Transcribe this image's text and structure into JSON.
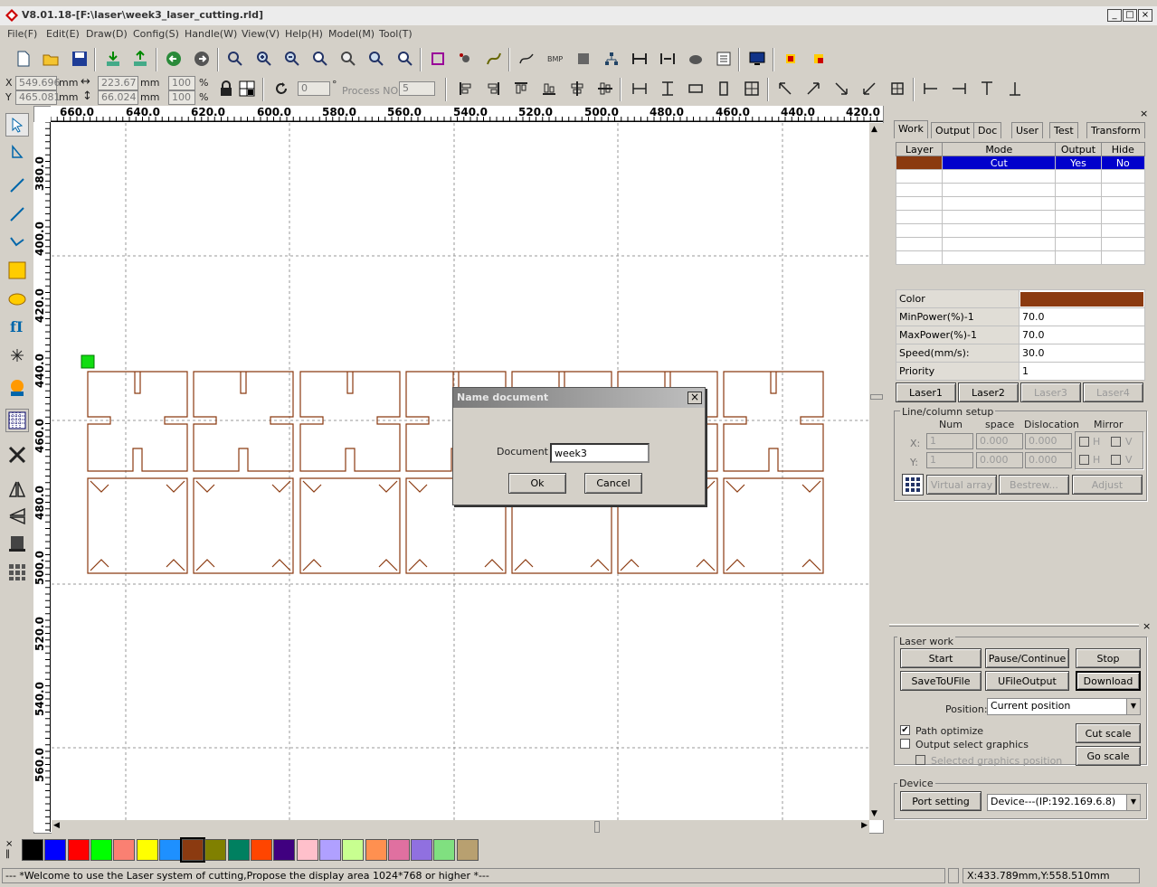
{
  "window": {
    "title": "V8.01.18-[F:\\laser\\week3_laser_cutting.rld]",
    "min": "_",
    "max": "□",
    "close": "×"
  },
  "menu": [
    "File(F)",
    "Edit(E)",
    "Draw(D)",
    "Config(S)",
    "Handle(W)",
    "View(V)",
    "Help(H)",
    "Model(M)",
    "Tool(T)"
  ],
  "coords": {
    "x_label": "X",
    "y_label": "Y",
    "x": "549.696",
    "y": "465.081",
    "unit": "mm",
    "w": "223.67",
    "h": "66.024",
    "pw": "100",
    "ph": "100",
    "pct": "%",
    "angle": "0",
    "deg": "°",
    "process_label": "Process NO:",
    "process": "5"
  },
  "rulers": {
    "h": [
      "660.0",
      "640.0",
      "620.0",
      "600.0",
      "580.0",
      "560.0",
      "540.0",
      "520.0",
      "500.0",
      "480.0",
      "460.0",
      "440.0",
      "420.0"
    ],
    "v": [
      "380.0",
      "400.0",
      "420.0",
      "440.0",
      "460.0",
      "480.0",
      "500.0",
      "520.0",
      "540.0",
      "560.0"
    ]
  },
  "tabs": [
    "Work",
    "Output",
    "Doc",
    "User",
    "Test",
    "Transform"
  ],
  "layers": {
    "headers": [
      "Layer",
      "Mode",
      "Output",
      "Hide"
    ],
    "rows": [
      {
        "color": "#8b3a10",
        "mode": "Cut",
        "output": "Yes",
        "hide": "No"
      }
    ]
  },
  "props": [
    {
      "k": "Color",
      "v": ""
    },
    {
      "k": "MinPower(%)-1",
      "v": "70.0"
    },
    {
      "k": "MaxPower(%)-1",
      "v": "70.0"
    },
    {
      "k": "Speed(mm/s):",
      "v": "30.0"
    },
    {
      "k": "Priority",
      "v": "1"
    }
  ],
  "laser_buttons": [
    "Laser1",
    "Laser2",
    "Laser3",
    "Laser4"
  ],
  "linecol": {
    "title": "Line/column setup",
    "num": "Num",
    "space": "space",
    "dislocation": "Dislocation",
    "mirror": "Mirror",
    "x": "X:",
    "y": "Y:",
    "x_num": "1",
    "x_space": "0.000",
    "x_disl": "0.000",
    "y_num": "1",
    "y_space": "0.000",
    "y_disl": "0.000",
    "h": "H",
    "v": "V",
    "virtual": "Virtual array",
    "bestrew": "Bestrew...",
    "adjust": "Adjust"
  },
  "laserwork": {
    "title": "Laser work",
    "start": "Start",
    "pause": "Pause/Continue",
    "stop": "Stop",
    "save": "SaveToUFile",
    "ufile": "UFileOutput",
    "download": "Download",
    "position_label": "Position:",
    "position": "Current position",
    "path_opt": "Path optimize",
    "output_sel": "Output select graphics",
    "sel_pos": "Selected graphics position",
    "cut_scale": "Cut scale",
    "go_scale": "Go scale"
  },
  "device": {
    "title": "Device",
    "port": "Port setting",
    "device": "Device---(IP:192.169.6.8)"
  },
  "palette": [
    "#000000",
    "#0000ff",
    "#ff0000",
    "#00ff00",
    "#fa8072",
    "#ffff00",
    "#1e90ff",
    "#8b3a10",
    "#808000",
    "#008060",
    "#ff4500",
    "#400080",
    "#ffc0cb",
    "#b0a0ff",
    "#c8ff90",
    "#ff9050",
    "#e070a0",
    "#9070e0",
    "#80e080",
    "#b8a070"
  ],
  "status": {
    "msg": "--- *Welcome to use the Laser system of cutting,Propose the display area 1024*768 or higher *---",
    "pos": "X:433.789mm,Y:558.510mm"
  },
  "dialog": {
    "title": "Name document",
    "label": "Document",
    "value": "week3",
    "ok": "Ok",
    "cancel": "Cancel",
    "close": "×"
  }
}
